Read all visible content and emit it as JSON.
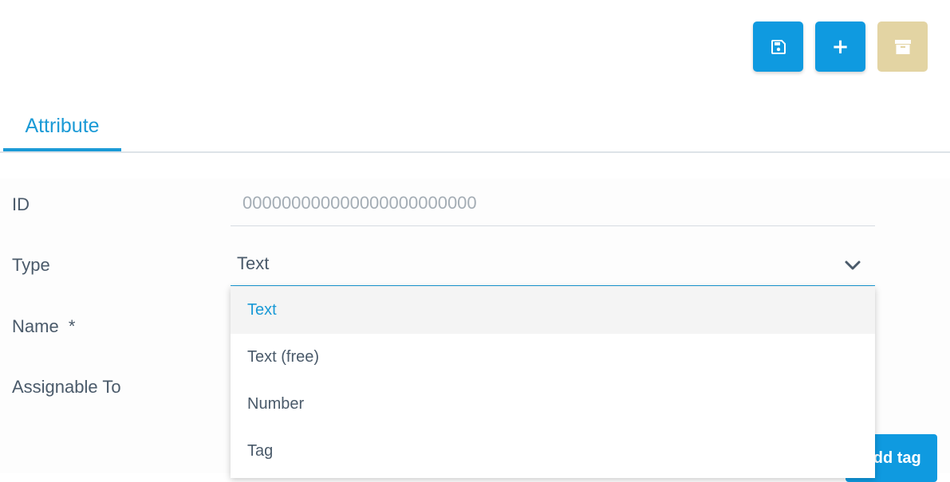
{
  "toolbar": {
    "save_icon": "floppy-disk-icon",
    "add_icon": "plus-icon",
    "add_glyph": "+",
    "archive_icon": "archive-box-icon",
    "primary_color": "#0f9ae0",
    "archive_color": "#e3d4a3"
  },
  "tabs": [
    {
      "label": "Attribute",
      "active": true
    }
  ],
  "form": {
    "id_label": "ID",
    "id_value": "000000000000000000000000",
    "type_label": "Type",
    "type_value": "Text",
    "name_label": "Name  *",
    "assignable_label": "Assignable To"
  },
  "dropdown": {
    "options": [
      "Text",
      "Text (free)",
      "Number",
      "Tag"
    ],
    "selected": "Text"
  },
  "add_tag_button": {
    "label": "Add tag"
  }
}
